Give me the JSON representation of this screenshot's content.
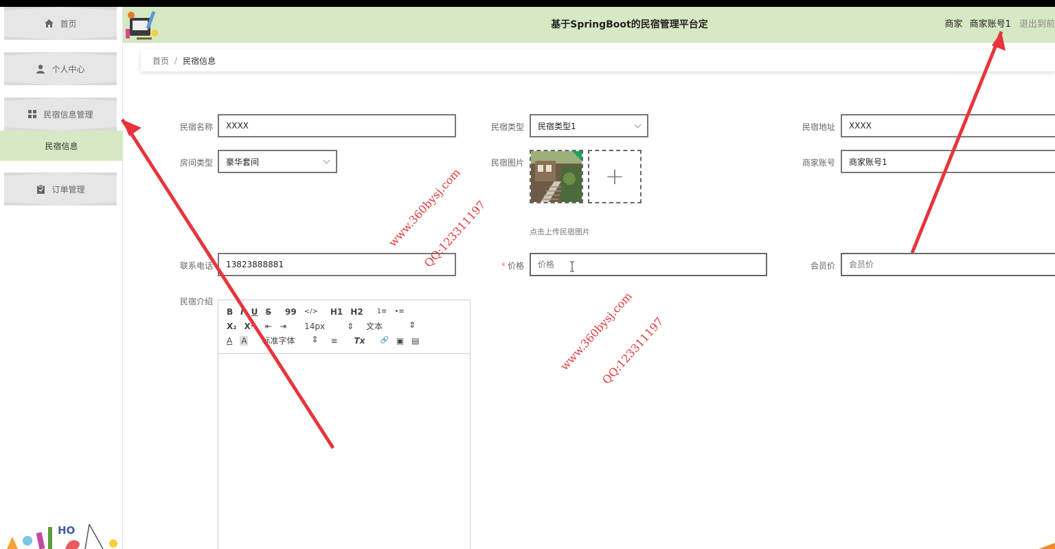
{
  "header": {
    "title": "基于SpringBoot的民宿管理平台定",
    "role": "商家",
    "username": "商家账号1",
    "logout": "退出到前"
  },
  "sidebar": {
    "items": [
      {
        "label": "首页",
        "icon": "home-icon"
      },
      {
        "label": "个人中心",
        "icon": "user-icon"
      },
      {
        "label": "民宿信息管理",
        "icon": "grid-icon"
      },
      {
        "label": "订单管理",
        "icon": "clipboard-icon"
      }
    ],
    "active_sub": "民宿信息"
  },
  "breadcrumb": {
    "home": "首页",
    "sep": "/",
    "current": "民宿信息"
  },
  "form": {
    "name": {
      "label": "民宿名称",
      "value": "XXXX"
    },
    "type": {
      "label": "民宿类型",
      "value": "民宿类型1"
    },
    "address": {
      "label": "民宿地址",
      "value": "XXXX"
    },
    "room_type": {
      "label": "房间类型",
      "value": "豪华套间"
    },
    "image": {
      "label": "民宿图片",
      "tip": "点击上传民宿图片",
      "plus": "+"
    },
    "merchant": {
      "label": "商家账号",
      "value": "商家账号1"
    },
    "phone": {
      "label": "联系电话",
      "value": "13823888881"
    },
    "price": {
      "label": "价格",
      "required": "*",
      "placeholder": "价格"
    },
    "member_price": {
      "label": "会员价",
      "placeholder": "会员价"
    },
    "intro": {
      "label": "民宿介绍"
    }
  },
  "editor": {
    "row1": [
      "B",
      "I",
      "U",
      "S",
      "99",
      "</>",
      "H1",
      "H2",
      "1≡",
      "•≡"
    ],
    "row2": [
      "X₂",
      "X²",
      "⇤",
      "⇥"
    ],
    "font_size": "14px",
    "header_select": "文本",
    "font_family": "标准字体",
    "row3": [
      "A",
      "A",
      "≡",
      "Tx",
      "🔗",
      "▣",
      "▤"
    ]
  },
  "watermarks": {
    "site": "www.360bysj.com",
    "qq": "QQ:123311197"
  },
  "colors": {
    "header_bg": "#d6e8c4",
    "active_sub_bg": "#d6e8c4",
    "arrow": "#e8343c"
  }
}
